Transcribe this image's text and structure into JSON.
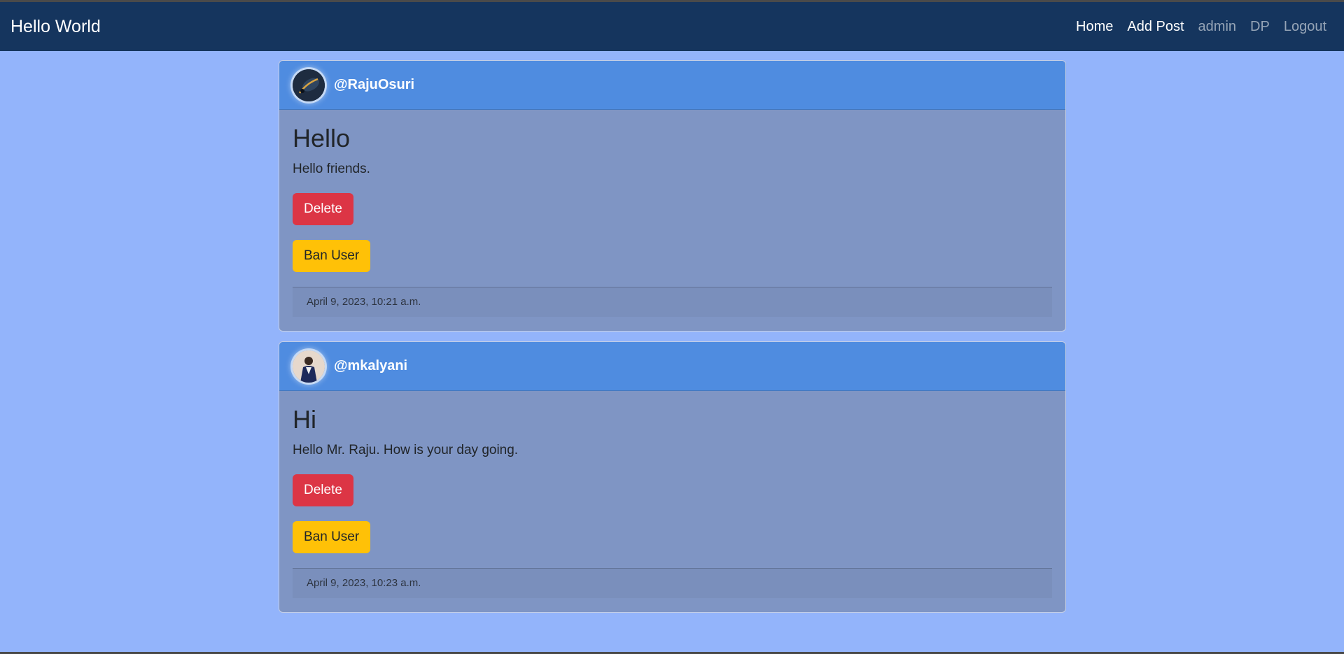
{
  "navbar": {
    "brand": "Hello World",
    "links": [
      {
        "label": "Home"
      },
      {
        "label": "Add Post"
      },
      {
        "label": "admin"
      },
      {
        "label": "DP"
      },
      {
        "label": "Logout"
      }
    ]
  },
  "posts": [
    {
      "username": "@RajuOsuri",
      "title": "Hello",
      "text": "Hello friends.",
      "delete_label": "Delete",
      "ban_label": "Ban User",
      "timestamp": "April 9, 2023, 10:21 a.m."
    },
    {
      "username": "@mkalyani",
      "title": "Hi",
      "text": "Hello Mr. Raju. How is your day going.",
      "delete_label": "Delete",
      "ban_label": "Ban User",
      "timestamp": "April 9, 2023, 10:23 a.m."
    }
  ],
  "colors": {
    "page_bg": "#93b4fb",
    "navbar_bg": "#15355e",
    "card_header_bg": "#4f8ce0",
    "card_body_bg": "#7f95c4",
    "danger": "#dc3545",
    "warning": "#ffc107"
  },
  "icons": {
    "avatar_1": "user-avatar-icon",
    "avatar_2": "user-avatar-icon"
  }
}
